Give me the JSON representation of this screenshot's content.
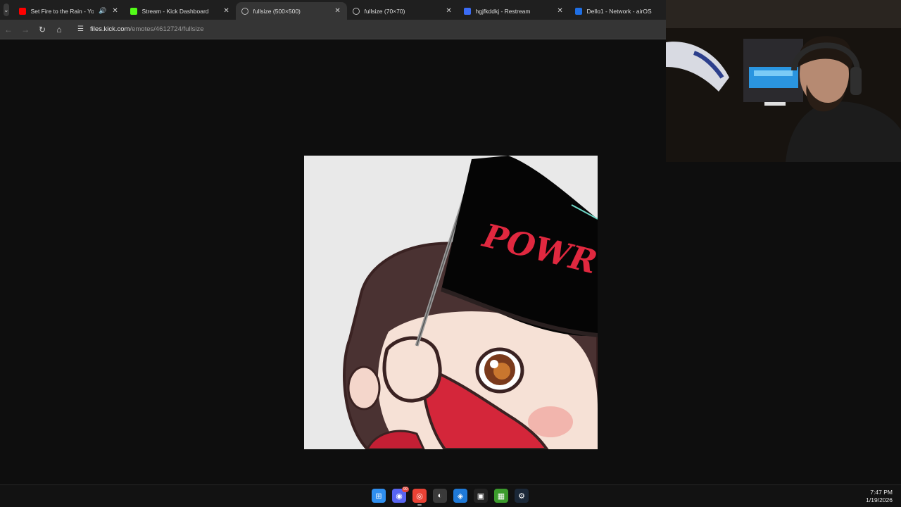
{
  "tabs": [
    {
      "title": "Set Fire to the Rain - YouTu",
      "favicon": "youtube-icon",
      "favicon_color": "#ff0000",
      "audio": true,
      "active": false
    },
    {
      "title": "Stream - Kick Dashboard",
      "favicon": "kick-icon",
      "favicon_color": "#53fc18",
      "audio": false,
      "active": false
    },
    {
      "title": "fullsize (500×500)",
      "favicon": "globe-icon",
      "favicon_color": "#bdbdbd",
      "audio": false,
      "active": true
    },
    {
      "title": "fullsize (70×70)",
      "favicon": "globe-icon",
      "favicon_color": "#bdbdbd",
      "audio": false,
      "active": false
    },
    {
      "title": "hgjfkddkj - Restream",
      "favicon": "restream-icon",
      "favicon_color": "#3b6cf6",
      "audio": false,
      "active": false
    },
    {
      "title": "Dello1 - Network - airOS",
      "favicon": "ubiquiti-icon",
      "favicon_color": "#1f6fe5",
      "audio": false,
      "active": false
    }
  ],
  "address": {
    "domain": "files.kick.com",
    "path": "/emotes/4612724/fullsize"
  },
  "emote": {
    "flag_text": "POWR"
  },
  "taskbar": {
    "apps": [
      {
        "name": "windows-start-icon",
        "glyph": "⊞",
        "color": "#2f8ff0"
      },
      {
        "name": "discord-icon",
        "glyph": "◉",
        "color": "#5865f2",
        "badge": "99"
      },
      {
        "name": "chrome-icon",
        "glyph": "◎",
        "color": "#e94235",
        "running": true
      },
      {
        "name": "obs-icon",
        "glyph": "◐",
        "color": "#3a3a3a"
      },
      {
        "name": "edge-icon",
        "glyph": "◈",
        "color": "#1f7ad9"
      },
      {
        "name": "capcut-icon",
        "glyph": "▣",
        "color": "#222222"
      },
      {
        "name": "minecraft-icon",
        "glyph": "▦",
        "color": "#3b9b2c"
      },
      {
        "name": "steam-icon",
        "glyph": "⚙",
        "color": "#1b2838"
      }
    ],
    "time": "7:47 PM",
    "date": "1/19/2026"
  }
}
